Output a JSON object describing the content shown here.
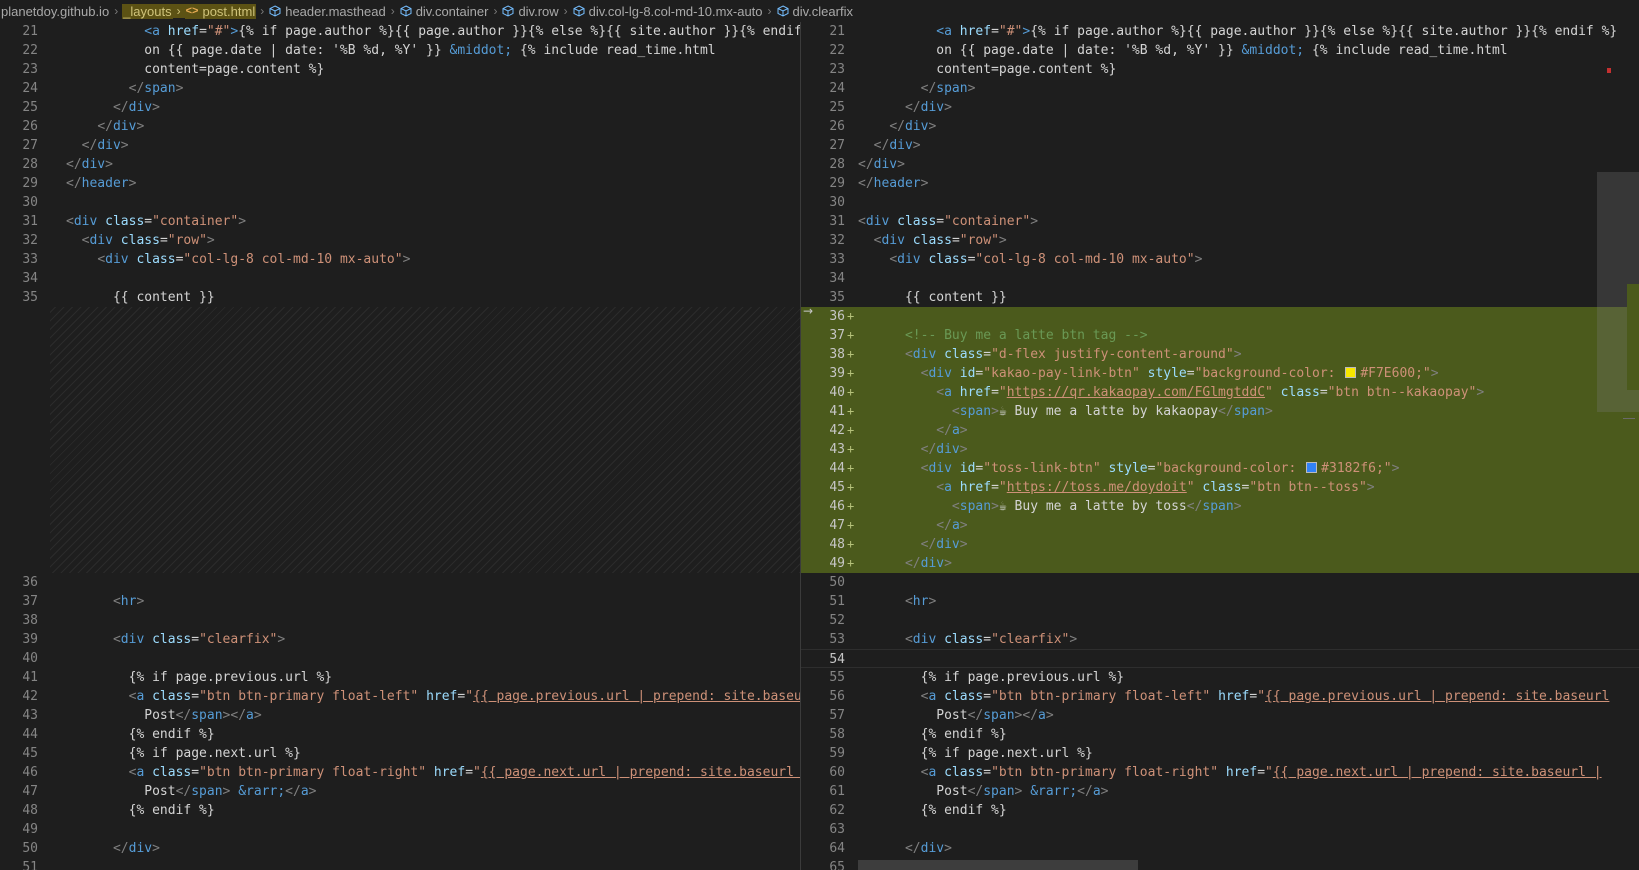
{
  "breadcrumb": {
    "root": "planetdoy.github.io",
    "folder": "_layouts",
    "file": "post.html",
    "symbols": [
      "header.masthead",
      "div.container",
      "div.row",
      "div.col-lg-8.col-md-10.mx-auto",
      "div.clearfix"
    ]
  },
  "left_top": [
    {
      "n": "21",
      "h": "          <span class='t'>&lt;a</span> <span class='a'>href</span>=<span class='s'>\"#\"</span><span class='t'>&gt;</span>{% if page.author %}{{ page.author }}{% else %}{{ site.author }}{% endif %}"
    },
    {
      "n": "22",
      "h": "          on {{ page.date | date: '%B %d, %Y' }} <span class='e'>&amp;middot;</span> {% include read_time.html"
    },
    {
      "n": "23",
      "h": "          content=page.content %}"
    },
    {
      "n": "24",
      "h": "        <span class='p'>&lt;/</span><span class='t'>span</span><span class='p'>&gt;</span>"
    },
    {
      "n": "25",
      "h": "      <span class='p'>&lt;/</span><span class='t'>div</span><span class='p'>&gt;</span>"
    },
    {
      "n": "26",
      "h": "    <span class='p'>&lt;/</span><span class='t'>div</span><span class='p'>&gt;</span>"
    },
    {
      "n": "27",
      "h": "  <span class='p'>&lt;/</span><span class='t'>div</span><span class='p'>&gt;</span>"
    },
    {
      "n": "28",
      "h": "<span class='p'>&lt;/</span><span class='t'>div</span><span class='p'>&gt;</span>"
    },
    {
      "n": "29",
      "h": "<span class='p'>&lt;/</span><span class='t'>header</span><span class='p'>&gt;</span>"
    },
    {
      "n": "30",
      "h": ""
    },
    {
      "n": "31",
      "h": "<span class='p'>&lt;</span><span class='t'>div</span> <span class='a'>class</span>=<span class='s'>\"container\"</span><span class='p'>&gt;</span>"
    },
    {
      "n": "32",
      "h": "  <span class='p'>&lt;</span><span class='t'>div</span> <span class='a'>class</span>=<span class='s'>\"row\"</span><span class='p'>&gt;</span>"
    },
    {
      "n": "33",
      "h": "    <span class='p'>&lt;</span><span class='t'>div</span> <span class='a'>class</span>=<span class='s'>\"col-lg-8 col-md-10 mx-auto\"</span><span class='p'>&gt;</span>"
    },
    {
      "n": "34",
      "h": ""
    },
    {
      "n": "35",
      "h": "      {{ content }}"
    }
  ],
  "left_bottom": [
    {
      "n": "36",
      "h": ""
    },
    {
      "n": "37",
      "h": "      <span class='p'>&lt;</span><span class='t'>hr</span><span class='p'>&gt;</span>"
    },
    {
      "n": "38",
      "h": ""
    },
    {
      "n": "39",
      "h": "      <span class='p'>&lt;</span><span class='t'>div</span> <span class='a'>class</span>=<span class='s'>\"clearfix\"</span><span class='p'>&gt;</span>"
    },
    {
      "n": "40",
      "h": ""
    },
    {
      "n": "41",
      "h": "        {% if page.previous.url %}"
    },
    {
      "n": "42",
      "h": "        <span class='p'>&lt;</span><span class='t'>a</span> <span class='a'>class</span>=<span class='s'>\"btn btn-primary float-left\"</span> <span class='a'>href</span>=<span class='s'>\"</span><span class='u'>{{ page.previous.url | prepend: site.baseurl</span>"
    },
    {
      "n": "43",
      "h": "          Post<span class='p'>&lt;/</span><span class='t'>span</span><span class='p'>&gt;&lt;/</span><span class='t'>a</span><span class='p'>&gt;</span>"
    },
    {
      "n": "44",
      "h": "        {% endif %}"
    },
    {
      "n": "45",
      "h": "        {% if page.next.url %}"
    },
    {
      "n": "46",
      "h": "        <span class='p'>&lt;</span><span class='t'>a</span> <span class='a'>class</span>=<span class='s'>\"btn btn-primary float-right\"</span> <span class='a'>href</span>=<span class='s'>\"</span><span class='u'>{{ page.next.url | prepend: site.baseurl |</span>"
    },
    {
      "n": "47",
      "h": "          Post<span class='p'>&lt;/</span><span class='t'>span</span><span class='p'>&gt;</span> <span class='e'>&amp;rarr;</span><span class='p'>&lt;/</span><span class='t'>a</span><span class='p'>&gt;</span>"
    },
    {
      "n": "48",
      "h": "        {% endif %}"
    },
    {
      "n": "49",
      "h": ""
    },
    {
      "n": "50",
      "h": "      <span class='p'>&lt;/</span><span class='t'>div</span><span class='p'>&gt;</span>"
    },
    {
      "n": "51",
      "h": ""
    }
  ],
  "right_lines": [
    {
      "n": "21",
      "h": "          <span class='t'>&lt;a</span> <span class='a'>href</span>=<span class='s'>\"#\"</span><span class='t'>&gt;</span>{% if page.author %}{{ page.author }}{% else %}{{ site.author }}{% endif %}"
    },
    {
      "n": "22",
      "h": "          on {{ page.date | date: '%B %d, %Y' }} <span class='e'>&amp;middot;</span> {% include read_time.html"
    },
    {
      "n": "23",
      "h": "          content=page.content %}"
    },
    {
      "n": "24",
      "h": "        <span class='p'>&lt;/</span><span class='t'>span</span><span class='p'>&gt;</span>"
    },
    {
      "n": "25",
      "h": "      <span class='p'>&lt;/</span><span class='t'>div</span><span class='p'>&gt;</span>"
    },
    {
      "n": "26",
      "h": "    <span class='p'>&lt;/</span><span class='t'>div</span><span class='p'>&gt;</span>"
    },
    {
      "n": "27",
      "h": "  <span class='p'>&lt;/</span><span class='t'>div</span><span class='p'>&gt;</span>"
    },
    {
      "n": "28",
      "h": "<span class='p'>&lt;/</span><span class='t'>div</span><span class='p'>&gt;</span>"
    },
    {
      "n": "29",
      "h": "<span class='p'>&lt;/</span><span class='t'>header</span><span class='p'>&gt;</span>"
    },
    {
      "n": "30",
      "h": ""
    },
    {
      "n": "31",
      "h": "<span class='p'>&lt;</span><span class='t'>div</span> <span class='a'>class</span>=<span class='s'>\"container\"</span><span class='p'>&gt;</span>"
    },
    {
      "n": "32",
      "h": "  <span class='p'>&lt;</span><span class='t'>div</span> <span class='a'>class</span>=<span class='s'>\"row\"</span><span class='p'>&gt;</span>"
    },
    {
      "n": "33",
      "h": "    <span class='p'>&lt;</span><span class='t'>div</span> <span class='a'>class</span>=<span class='s'>\"col-lg-8 col-md-10 mx-auto\"</span><span class='p'>&gt;</span>"
    },
    {
      "n": "34",
      "h": ""
    },
    {
      "n": "35",
      "h": "      {{ content }}"
    },
    {
      "n": "36",
      "h": "",
      "add": true
    },
    {
      "n": "37",
      "h": "      <span class='c'>&lt;!-- Buy me a latte btn tag --&gt;</span>",
      "add": true
    },
    {
      "n": "38",
      "h": "      <span class='p'>&lt;</span><span class='t'>div</span> <span class='a'>class</span>=<span class='s'>\"d-flex justify-content-around\"</span><span class='p'>&gt;</span>",
      "add": true
    },
    {
      "n": "39",
      "h": "        <span class='p'>&lt;</span><span class='t'>div</span> <span class='a'>id</span>=<span class='s'>\"kakao-pay-link-btn\"</span> <span class='a'>style</span>=<span class='s'>\"background-color: </span><span class='sw' style='background:#F7E600'></span><span class='s'>#F7E600;\"</span><span class='p'>&gt;</span>",
      "add": true
    },
    {
      "n": "40",
      "h": "          <span class='p'>&lt;</span><span class='t'>a</span> <span class='a'>href</span>=<span class='s'>\"</span><span class='u'>https://qr.kakaopay.com/FGlmgtddC</span><span class='s'>\"</span> <span class='a'>class</span>=<span class='s'>\"btn btn--kakaopay\"</span><span class='p'>&gt;</span>",
      "add": true
    },
    {
      "n": "41",
      "h": "            <span class='p'>&lt;</span><span class='t'>span</span><span class='p'>&gt;</span><span class='x'>☕ Buy me a latte by kakaopay</span><span class='p'>&lt;/</span><span class='t'>span</span><span class='p'>&gt;</span>",
      "add": true
    },
    {
      "n": "42",
      "h": "          <span class='p'>&lt;/</span><span class='t'>a</span><span class='p'>&gt;</span>",
      "add": true
    },
    {
      "n": "43",
      "h": "        <span class='p'>&lt;/</span><span class='t'>div</span><span class='p'>&gt;</span>",
      "add": true
    },
    {
      "n": "44",
      "h": "        <span class='p'>&lt;</span><span class='t'>div</span> <span class='a'>id</span>=<span class='s'>\"toss-link-btn\"</span> <span class='a'>style</span>=<span class='s'>\"background-color: </span><span class='sw' style='background:#3182f6'></span><span class='s'>#3182f6;\"</span><span class='p'>&gt;</span>",
      "add": true
    },
    {
      "n": "45",
      "h": "          <span class='p'>&lt;</span><span class='t'>a</span> <span class='a'>href</span>=<span class='s'>\"</span><span class='u'>https://toss.me/doydoit</span><span class='s'>\"</span> <span class='a'>class</span>=<span class='s'>\"btn btn--toss\"</span><span class='p'>&gt;</span>",
      "add": true
    },
    {
      "n": "46",
      "h": "            <span class='p'>&lt;</span><span class='t'>span</span><span class='p'>&gt;</span><span class='x'>☕ Buy me a latte by toss</span><span class='p'>&lt;/</span><span class='t'>span</span><span class='p'>&gt;</span>",
      "add": true
    },
    {
      "n": "47",
      "h": "          <span class='p'>&lt;/</span><span class='t'>a</span><span class='p'>&gt;</span>",
      "add": true
    },
    {
      "n": "48",
      "h": "        <span class='p'>&lt;/</span><span class='t'>div</span><span class='p'>&gt;</span>",
      "add": true
    },
    {
      "n": "49",
      "h": "      <span class='p'>&lt;/</span><span class='t'>div</span><span class='p'>&gt;</span>",
      "add": true
    },
    {
      "n": "50",
      "h": ""
    },
    {
      "n": "51",
      "h": "      <span class='p'>&lt;</span><span class='t'>hr</span><span class='p'>&gt;</span>"
    },
    {
      "n": "52",
      "h": ""
    },
    {
      "n": "53",
      "h": "      <span class='p'>&lt;</span><span class='t'>div</span> <span class='a'>class</span>=<span class='s'>\"clearfix\"</span><span class='p'>&gt;</span>"
    },
    {
      "n": "54",
      "h": "",
      "cur": true
    },
    {
      "n": "55",
      "h": "        {% if page.previous.url %}"
    },
    {
      "n": "56",
      "h": "        <span class='p'>&lt;</span><span class='t'>a</span> <span class='a'>class</span>=<span class='s'>\"btn btn-primary float-left\"</span> <span class='a'>href</span>=<span class='s'>\"</span><span class='u'>{{ page.previous.url | prepend: site.baseurl</span>"
    },
    {
      "n": "57",
      "h": "          Post<span class='p'>&lt;/</span><span class='t'>span</span><span class='p'>&gt;&lt;/</span><span class='t'>a</span><span class='p'>&gt;</span>"
    },
    {
      "n": "58",
      "h": "        {% endif %}"
    },
    {
      "n": "59",
      "h": "        {% if page.next.url %}"
    },
    {
      "n": "60",
      "h": "        <span class='p'>&lt;</span><span class='t'>a</span> <span class='a'>class</span>=<span class='s'>\"btn btn-primary float-right\"</span> <span class='a'>href</span>=<span class='s'>\"</span><span class='u'>{{ page.next.url | prepend: site.baseurl |</span>"
    },
    {
      "n": "61",
      "h": "          Post<span class='p'>&lt;/</span><span class='t'>span</span><span class='p'>&gt;</span> <span class='e'>&amp;rarr;</span><span class='p'>&lt;/</span><span class='t'>a</span><span class='p'>&gt;</span>"
    },
    {
      "n": "62",
      "h": "        {% endif %}"
    },
    {
      "n": "63",
      "h": ""
    },
    {
      "n": "64",
      "h": "      <span class='p'>&lt;/</span><span class='t'>div</span><span class='p'>&gt;</span>"
    },
    {
      "n": "65",
      "h": ""
    }
  ],
  "colors": {
    "added_bg": "#4b5a1c",
    "kakao": "#F7E600",
    "toss": "#3182f6"
  }
}
